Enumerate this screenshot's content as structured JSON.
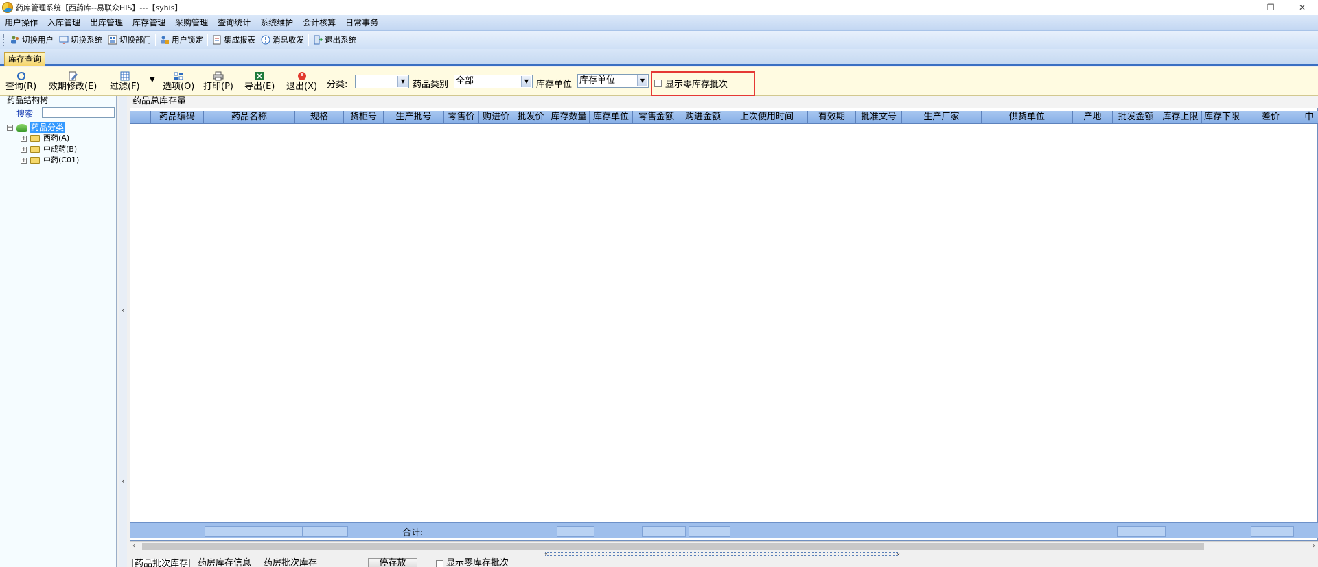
{
  "window": {
    "title": "药库管理系统【西药库--易联众HIS】---【syhis】",
    "minimize": "—",
    "restore": "❐",
    "close": "✕"
  },
  "menu": [
    "用户操作",
    "入库管理",
    "出库管理",
    "库存管理",
    "采购管理",
    "查询统计",
    "系统维护",
    "会计核算",
    "日常事务"
  ],
  "toolbar": [
    "切换用户",
    "切换系统",
    "切换部门",
    "用户锁定",
    "集成报表",
    "消息收发",
    "退出系统"
  ],
  "tab": {
    "label": "库存查询"
  },
  "query_bar": {
    "buttons": [
      "查询(R)",
      "效期修改(E)",
      "过滤(F)",
      "选项(O)",
      "打印(P)",
      "导出(E)",
      "退出(X)"
    ],
    "category_label": "分类:",
    "category_value": "",
    "drug_type_label": "药品类别",
    "drug_type_value": "全部",
    "unit_label": "库存单位",
    "unit_value": "库存单位",
    "show_zero_label": "显示零库存批次",
    "show_zero_checked": false
  },
  "left_panel": {
    "title": "药品结构树",
    "search_label": "搜索",
    "search_value": "",
    "tree_root": "药品分类",
    "tree_children": [
      "西药(A)",
      "中成药(B)",
      "中药(C01)"
    ]
  },
  "grid": {
    "title": "药品总库存量",
    "columns": [
      "药品编码",
      "药品名称",
      "规格",
      "货柜号",
      "生产批号",
      "零售价",
      "购进价",
      "批发价",
      "库存数量",
      "库存单位",
      "零售金额",
      "购进金额",
      "上次使用时间",
      "有效期",
      "批准文号",
      "生产厂家",
      "供货单位",
      "产地",
      "批发金额",
      "库存上限",
      "库存下限",
      "差价",
      "中"
    ],
    "rows": [],
    "sum_label": "合计:"
  },
  "bottom": {
    "tabs": [
      "药品批次库存",
      "药房库存信息",
      "药房批次库存"
    ],
    "stock_button": "停存放",
    "show_zero_label": "显示零库存批次"
  }
}
